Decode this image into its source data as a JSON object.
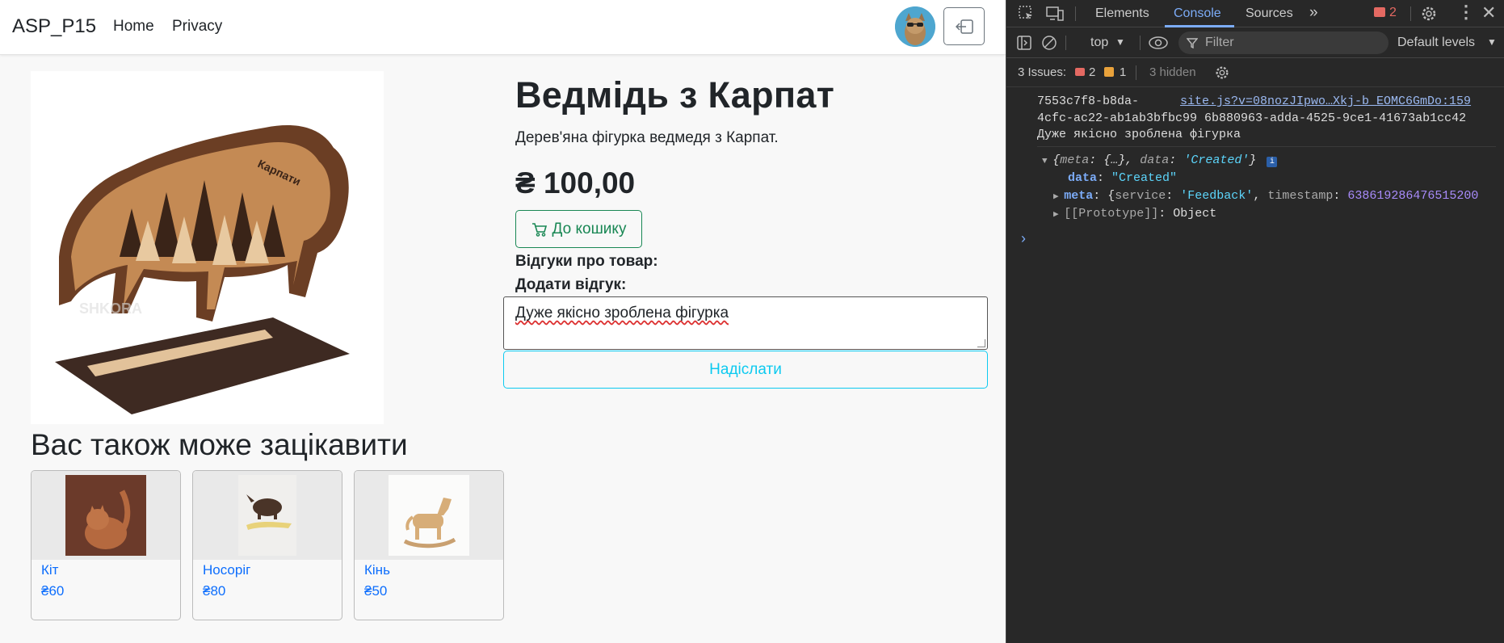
{
  "navbar": {
    "brand": "ASP_P15",
    "links": [
      "Home",
      "Privacy"
    ]
  },
  "product": {
    "title": "Ведмідь з Карпат",
    "description": "Дерев'яна фігурка ведмедя з Карпат.",
    "price": "₴ 100,00",
    "add_to_cart_label": "До кошику",
    "reviews_label": "Відгуки про товар:",
    "add_review_label": "Додати відгук:",
    "review_text": "Дуже якісно зроблена фігурка",
    "send_label": "Надіслати",
    "image_text": "Карпати",
    "watermark": "SHKORA"
  },
  "related": {
    "heading": "Вас також може зацікавити",
    "items": [
      {
        "name": "Кіт",
        "price": "₴60"
      },
      {
        "name": "Носоріг",
        "price": "₴80"
      },
      {
        "name": "Кінь",
        "price": "₴50"
      }
    ]
  },
  "devtools": {
    "tabs": [
      "Elements",
      "Console",
      "Sources"
    ],
    "active_tab": "Console",
    "error_count": "2",
    "context": "top",
    "filter_placeholder": "Filter",
    "levels": "Default levels",
    "issues_label": "3 Issues:",
    "issues_errors": "2",
    "issues_warnings": "1",
    "issues_hidden": "3 hidden",
    "log_line1_left": "7553c7f8-b8da-",
    "log_source": "site.js?v=08nozJIpwo…Xkj-b_EOMC6GmDo:159",
    "log_line2": "4cfc-ac22-ab1ab3bfbc99 6b880963-adda-4525-9ce1-41673ab1cc42",
    "log_line3": "Дуже якісно зроблена фігурка",
    "obj_summary_meta": "meta",
    "obj_summary_meta_val": "{…}",
    "obj_summary_data": "data",
    "obj_summary_data_val": "'Created'",
    "obj_data_key": "data",
    "obj_data_val": "\"Created\"",
    "obj_meta_key": "meta",
    "obj_meta_service_key": "service",
    "obj_meta_service_val": "'Feedback'",
    "obj_meta_ts_key": "timestamp",
    "obj_meta_ts_val": "638619286476515200",
    "obj_proto": "[[Prototype]]",
    "obj_proto_val": "Object"
  }
}
